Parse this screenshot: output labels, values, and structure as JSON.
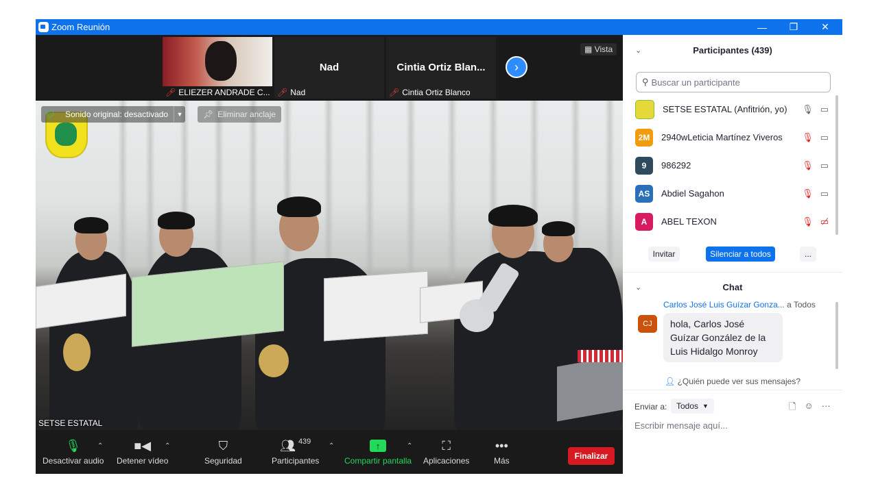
{
  "window": {
    "title": "Zoom Reunión",
    "minimize": "—",
    "restore": "❐",
    "close": "✕"
  },
  "strip": {
    "tiles": [
      {
        "name": "",
        "footer": "ELIEZER ANDRADE C...",
        "has_video": true
      },
      {
        "name": "Nad",
        "footer": "Nad",
        "has_video": false
      },
      {
        "name": "Cintia  Ortiz  Blan...",
        "footer": "Cintia Ortiz Blanco",
        "has_video": false
      }
    ],
    "next_icon": "chevron-right-icon",
    "view_label": "Vista"
  },
  "video": {
    "sound_label": "Sonido original: desactivado",
    "unpin_label": "Eliminar anclaje",
    "speaker_name": "SETSE ESTATAL"
  },
  "toolbar": {
    "audio_label": "Desactivar audio",
    "video_label": "Detener vídeo",
    "security_label": "Seguridad",
    "participants_label": "Participantes",
    "participants_count": "439",
    "share_label": "Compartir pantalla",
    "apps_label": "Aplicaciones",
    "more_label": "Más",
    "end_label": "Finalizar",
    "share_color": "#23d959",
    "end_color": "#d71921"
  },
  "participants": {
    "title": "Participantes (439)",
    "search_placeholder": "Buscar un participante",
    "list": [
      {
        "initials": "",
        "name": "SETSE ESTATAL (Anfitrión, yo)",
        "color": "#e6d838",
        "mic_muted": false,
        "video_off": false
      },
      {
        "initials": "2M",
        "name": "2940wLeticia Martínez Viveros",
        "color": "#f29b0c",
        "mic_muted": true,
        "video_off": false
      },
      {
        "initials": "9",
        "name": "986292",
        "color": "#2f4a5f",
        "mic_muted": true,
        "video_off": false
      },
      {
        "initials": "AS",
        "name": "Abdiel Sagahon",
        "color": "#2a70b8",
        "mic_muted": true,
        "video_off": false
      },
      {
        "initials": "A",
        "name": "ABEL TEXON",
        "color": "#d81b60",
        "mic_muted": true,
        "video_off": true
      }
    ],
    "invite_label": "Invitar",
    "mute_all_label": "Silenciar a todos",
    "more_label": "..."
  },
  "chat": {
    "title": "Chat",
    "from": "Carlos José Luis Guízar Gonza...",
    "to": "a Todos",
    "avatar": "CJ",
    "message": "hola, Carlos José Guízar González de la Luis Hidalgo Monroy",
    "who_can_see": "¿Quién puede ver sus mensajes?",
    "send_to_label": "Enviar a:",
    "send_to_value": "Todos",
    "input_placeholder": "Escribir mensaje aquí..."
  }
}
